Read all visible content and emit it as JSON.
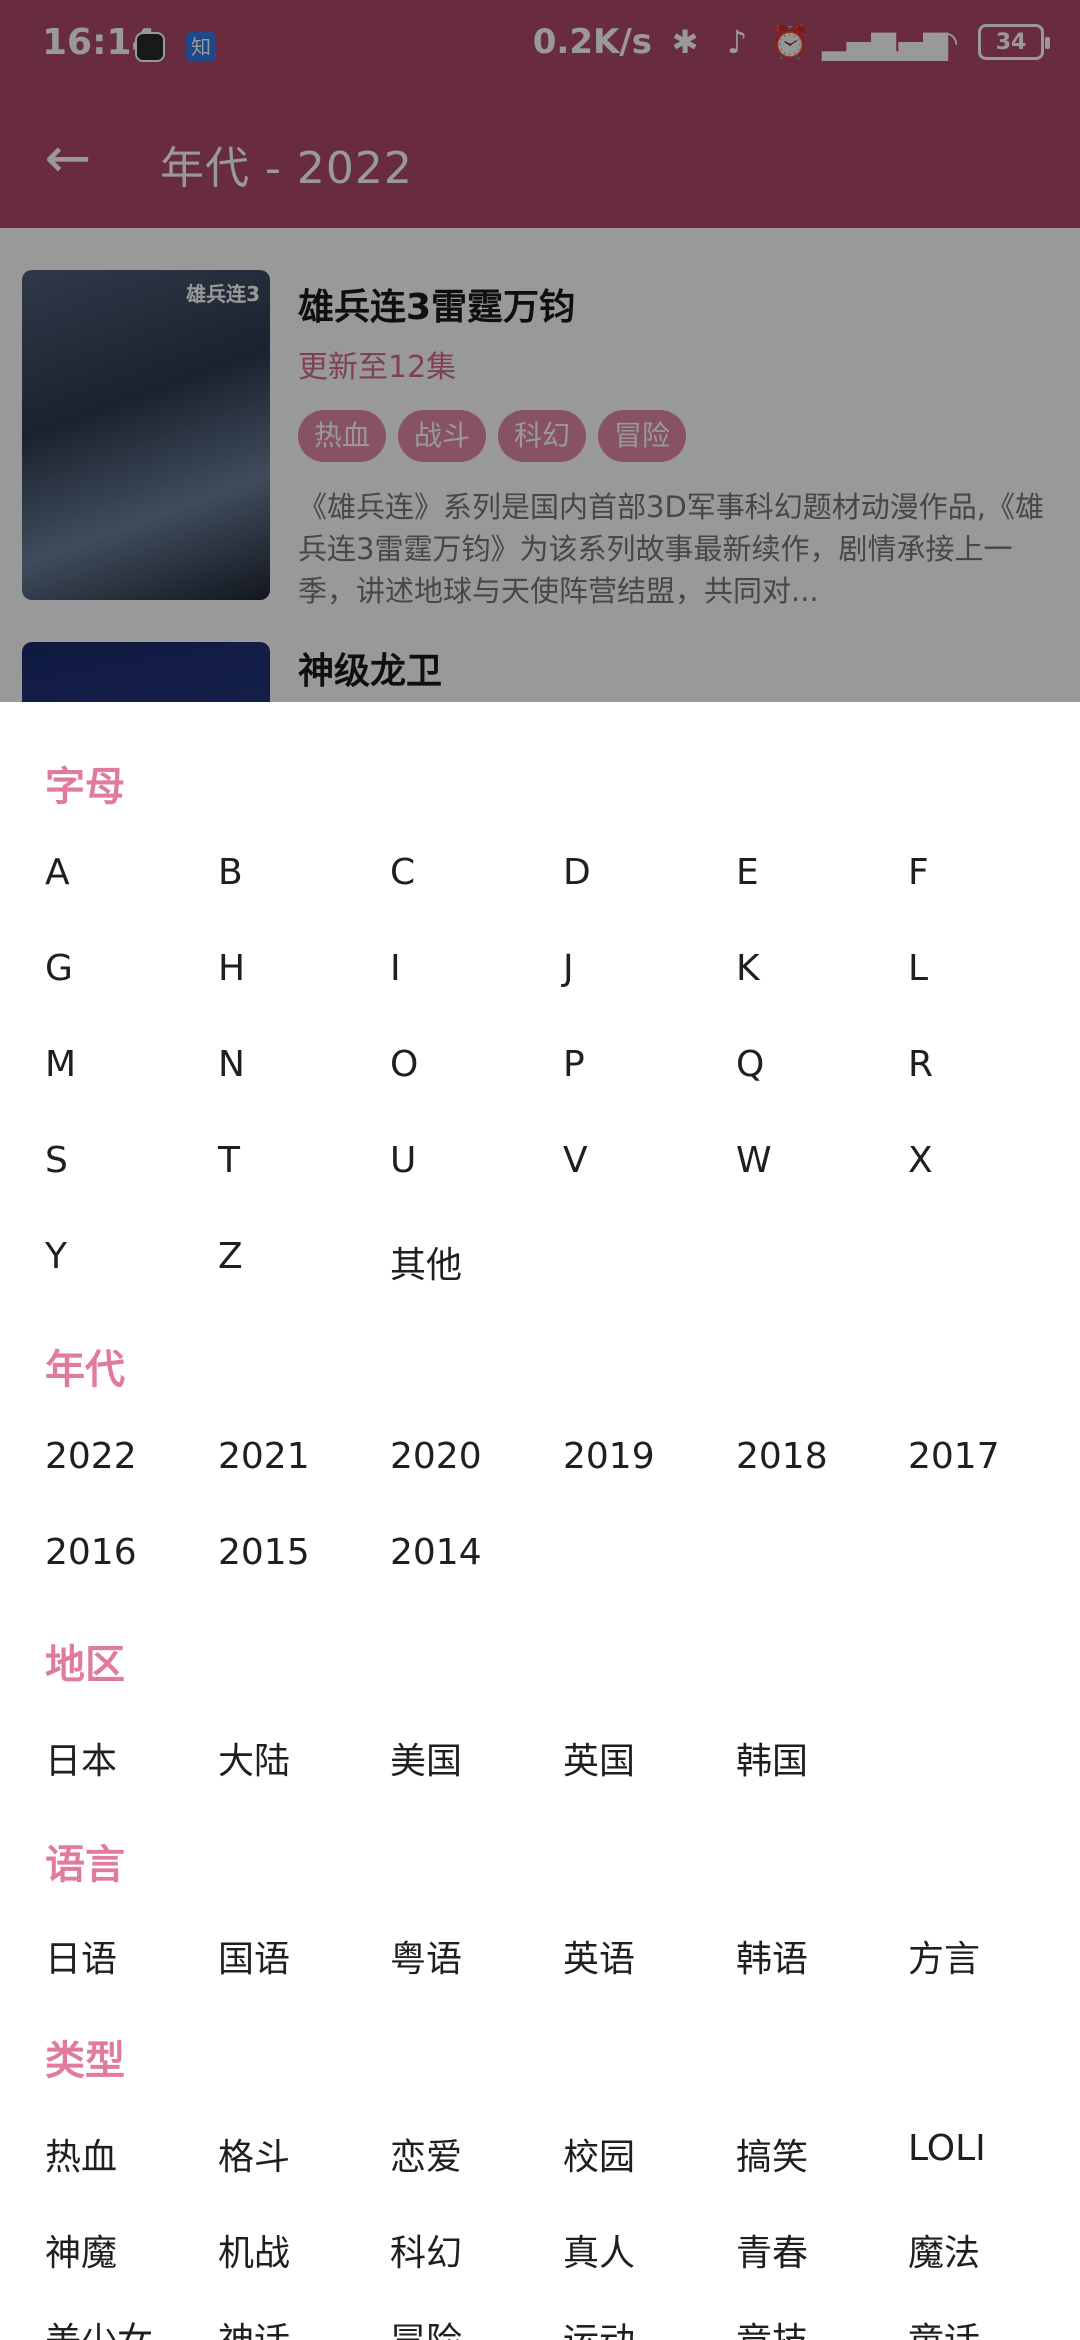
{
  "status_bar": {
    "time": "16:14",
    "app_icon_2_text": "知",
    "network_speed": "0.2K/s",
    "battery": "34",
    "icons": [
      "bluetooth-icon",
      "mute-icon",
      "alarm-icon",
      "signal-hd-icon",
      "signal-hd-icon",
      "wifi-icon",
      "battery-icon"
    ]
  },
  "app_bar": {
    "title": "年代 - 2022",
    "back_icon": "arrow-left-icon"
  },
  "list": [
    {
      "title": "雄兵连3雷霆万钧",
      "update": "更新至12集",
      "tags": [
        "热血",
        "战斗",
        "科幻",
        "冒险"
      ],
      "description": "《雄兵连》系列是国内首部3D军事科幻题材动漫作品,《雄兵连3雷霆万钧》为该系列故事最新续作，剧情承接上一季，讲述地球与天使阵营结盟，共同对...",
      "poster_logo": "雄兵连3"
    },
    {
      "title": "神级龙卫"
    }
  ],
  "filter": {
    "letters": {
      "title": "字母",
      "options": [
        "A",
        "B",
        "C",
        "D",
        "E",
        "F",
        "G",
        "H",
        "I",
        "J",
        "K",
        "L",
        "M",
        "N",
        "O",
        "P",
        "Q",
        "R",
        "S",
        "T",
        "U",
        "V",
        "W",
        "X",
        "Y",
        "Z",
        "其他"
      ]
    },
    "years": {
      "title": "年代",
      "options": [
        "2022",
        "2021",
        "2020",
        "2019",
        "2018",
        "2017",
        "2016",
        "2015",
        "2014"
      ]
    },
    "regions": {
      "title": "地区",
      "options": [
        "日本",
        "大陆",
        "美国",
        "英国",
        "韩国"
      ]
    },
    "languages": {
      "title": "语言",
      "options": [
        "日语",
        "国语",
        "粤语",
        "英语",
        "韩语",
        "方言"
      ]
    },
    "types": {
      "title": "类型",
      "options": [
        "热血",
        "格斗",
        "恋爱",
        "校园",
        "搞笑",
        "LOLI",
        "神魔",
        "机战",
        "科幻",
        "真人",
        "青春",
        "魔法",
        "美少女",
        "神话",
        "冒险",
        "运动",
        "竞技",
        "童话"
      ]
    }
  },
  "colors": {
    "primary": "#b04a6a",
    "section_title": "#e07a9e",
    "tag_bg": "#e28aa7"
  }
}
